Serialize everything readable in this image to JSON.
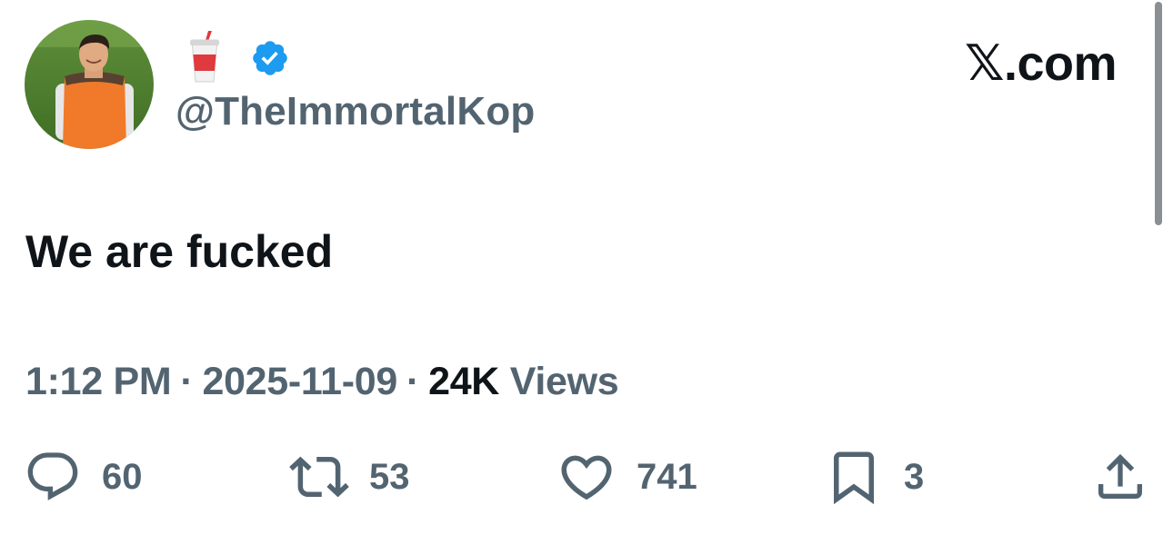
{
  "brand": {
    "label": "𝕏.com"
  },
  "user": {
    "handle": "@TheImmortalKop",
    "name_icon": "drink-cup-emoji",
    "verified_icon": "verified-badge-icon"
  },
  "tweet": {
    "text": "We are fucked"
  },
  "meta": {
    "time": "1:12 PM",
    "separator": "·",
    "date": "2025-11-09",
    "views_count": "24K",
    "views_label": "Views"
  },
  "actions": {
    "replies": "60",
    "retweets": "53",
    "likes": "741",
    "bookmarks": "3"
  },
  "colors": {
    "primary_text": "#0f1419",
    "secondary_text": "#536471",
    "verified": "#1d9bf0"
  }
}
